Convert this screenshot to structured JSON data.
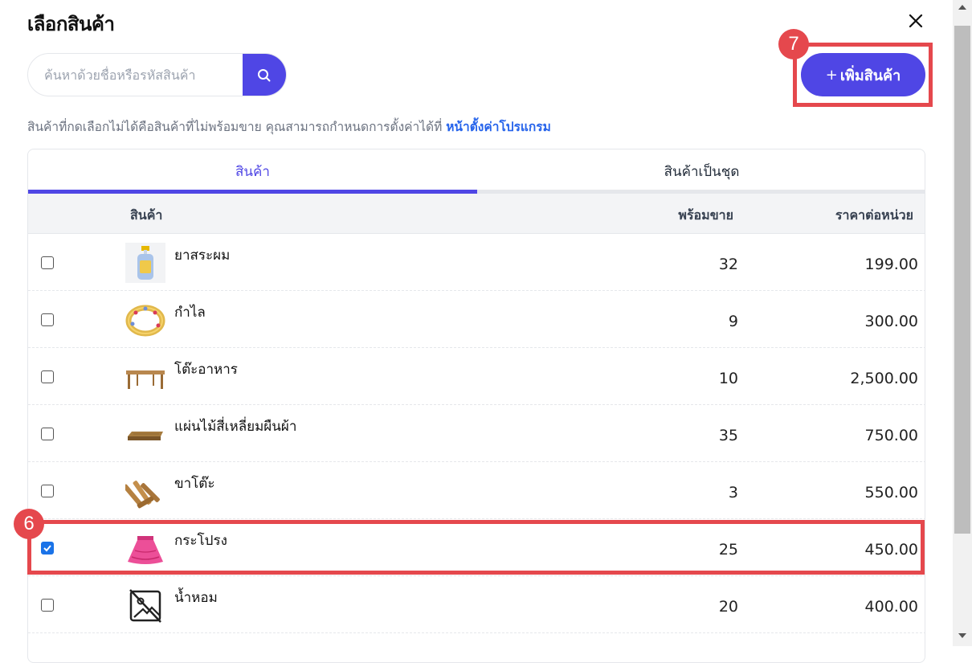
{
  "dialog": {
    "title": "เลือกสินค้า",
    "search_placeholder": "ค้นหาด้วยชื่อหรือรหัสสินค้า",
    "add_button_plus": "+",
    "add_button_label": "เพิ่มสินค้า",
    "hint_text": "สินค้าที่กดเลือกไม่ได้คือสินค้าที่ไม่พร้อมขาย คุณสามารถกำหนดการตั้งค่าได้ที่ ",
    "hint_link": "หน้าตั้งค่าโปรแกรม"
  },
  "tabs": [
    {
      "label": "สินค้า",
      "active": true
    },
    {
      "label": "สินค้าเป็นชุด",
      "active": false
    }
  ],
  "table": {
    "headers": {
      "product": "สินค้า",
      "stock": "พร้อมขาย",
      "price": "ราคาต่อหน่วย"
    },
    "rows": [
      {
        "name": "ยาสระผม",
        "stock": "32",
        "price": "199.00",
        "checked": false,
        "icon": "shampoo-bottle"
      },
      {
        "name": "กำไล",
        "stock": "9",
        "price": "300.00",
        "checked": false,
        "icon": "bracelet"
      },
      {
        "name": "โต๊ะอาหาร",
        "stock": "10",
        "price": "2,500.00",
        "checked": false,
        "icon": "dining-table"
      },
      {
        "name": "แผ่นไม้สี่เหลี่ยมผืนผ้า",
        "stock": "35",
        "price": "750.00",
        "checked": false,
        "icon": "wood-plank"
      },
      {
        "name": "ขาโต๊ะ",
        "stock": "3",
        "price": "550.00",
        "checked": false,
        "icon": "table-legs"
      },
      {
        "name": "กระโปรง",
        "stock": "25",
        "price": "450.00",
        "checked": true,
        "icon": "skirt"
      },
      {
        "name": "น้ำหอม",
        "stock": "20",
        "price": "400.00",
        "checked": false,
        "icon": "no-image"
      }
    ]
  },
  "annotations": [
    {
      "number": "7",
      "target": "add-product-button"
    },
    {
      "number": "6",
      "target": "skirt-row"
    }
  ],
  "colors": {
    "accent": "#4f46e5",
    "annotation": "#e5484d",
    "link": "#2563eb"
  }
}
